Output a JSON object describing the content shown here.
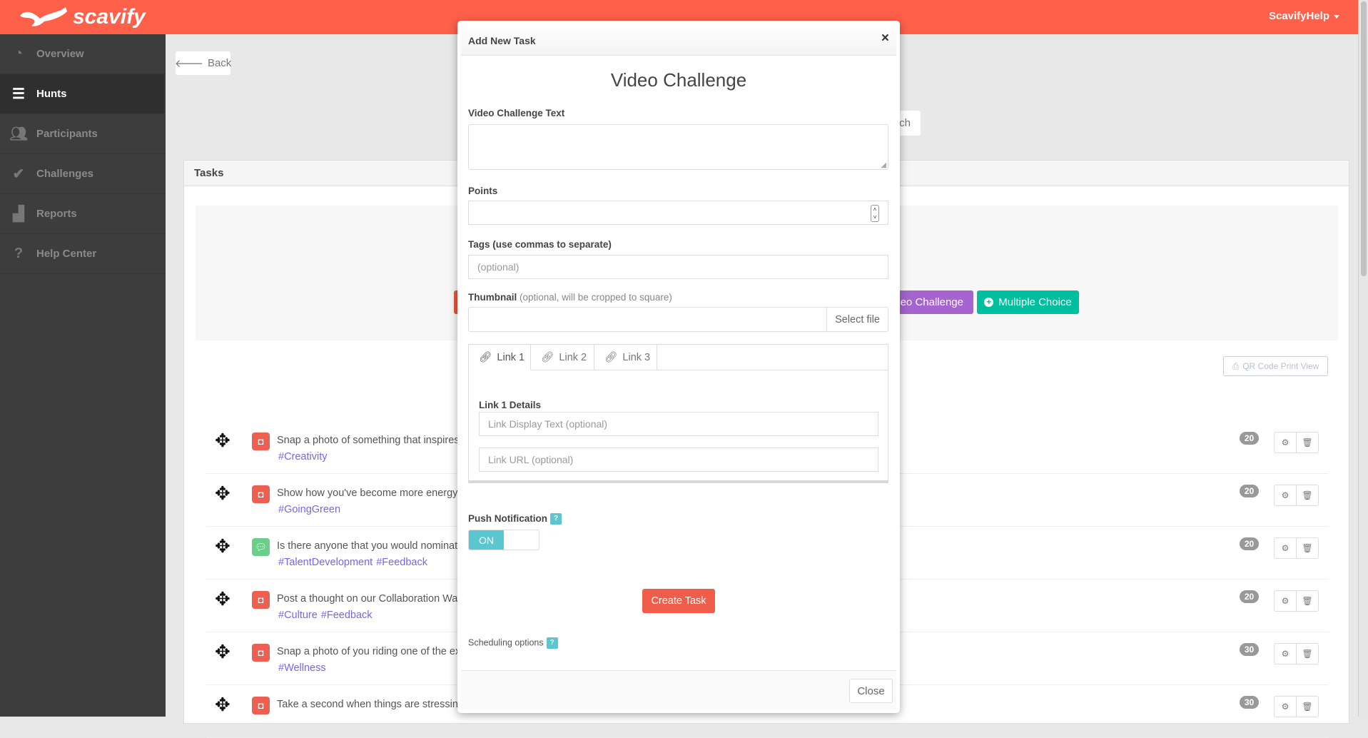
{
  "brand": {
    "name": "scavify",
    "color": "#ff604a"
  },
  "header": {
    "user": "ScavifyHelp"
  },
  "sidebar": {
    "items": [
      {
        "label": "Overview",
        "icon": "dashboard-icon"
      },
      {
        "label": "Hunts",
        "icon": "list-icon",
        "active": true
      },
      {
        "label": "Participants",
        "icon": "users-icon"
      },
      {
        "label": "Challenges",
        "icon": "check-circle-icon"
      },
      {
        "label": "Reports",
        "icon": "bar-chart-icon"
      },
      {
        "label": "Help Center",
        "icon": "question-circle-icon"
      }
    ]
  },
  "page": {
    "back": "Back",
    "partial_button": "ch",
    "tasks_title": "Tasks",
    "add_buttons": {
      "video": "deo Challenge",
      "multiple_choice": "Multiple Choice"
    },
    "qr": "QR Code Print View",
    "tasks": [
      {
        "text": "Snap a photo of something that inspires y",
        "tags": [
          "#Creativity"
        ],
        "points": "20",
        "type": "photo"
      },
      {
        "text": "Show how you've become more energy e",
        "tags": [
          "#GoingGreen"
        ],
        "points": "20",
        "type": "photo"
      },
      {
        "text": "Is there anyone that you would nominate",
        "tags": [
          "#TalentDevelopment",
          "#Feedback"
        ],
        "points": "20",
        "type": "text"
      },
      {
        "text": "Post a thought on our Collaboration Wall.",
        "tags": [
          "#Culture",
          "#Feedback"
        ],
        "points": "20",
        "type": "photo"
      },
      {
        "text": "Snap a photo of you riding one of the exe",
        "tags": [
          "#Wellness"
        ],
        "points": "30",
        "type": "photo"
      },
      {
        "text": "Take a second when things are stressing",
        "tags": [],
        "points": "30",
        "type": "photo"
      }
    ]
  },
  "modal": {
    "title": "Add New Task",
    "close_x": "×",
    "heading": "Video Challenge",
    "text_label": "Video Challenge Text",
    "text_value": "",
    "points_label": "Points",
    "points_value": "",
    "tags_label": "Tags (use commas to separate)",
    "tags_placeholder": "(optional)",
    "thumb_label": "Thumbnail",
    "thumb_sub": "(optional, will be cropped to square)",
    "select_file": "Select file",
    "tabs": [
      "Link 1",
      "Link 2",
      "Link 3"
    ],
    "active_tab": 0,
    "link_details": "Link 1 Details",
    "link_text_placeholder": "Link Display Text (optional)",
    "link_url_placeholder": "Link URL (optional)",
    "push_label": "Push Notification",
    "help": "?",
    "toggle": "ON",
    "push_on": true,
    "create": "Create Task",
    "scheduling": "Scheduling options",
    "close": "Close"
  }
}
